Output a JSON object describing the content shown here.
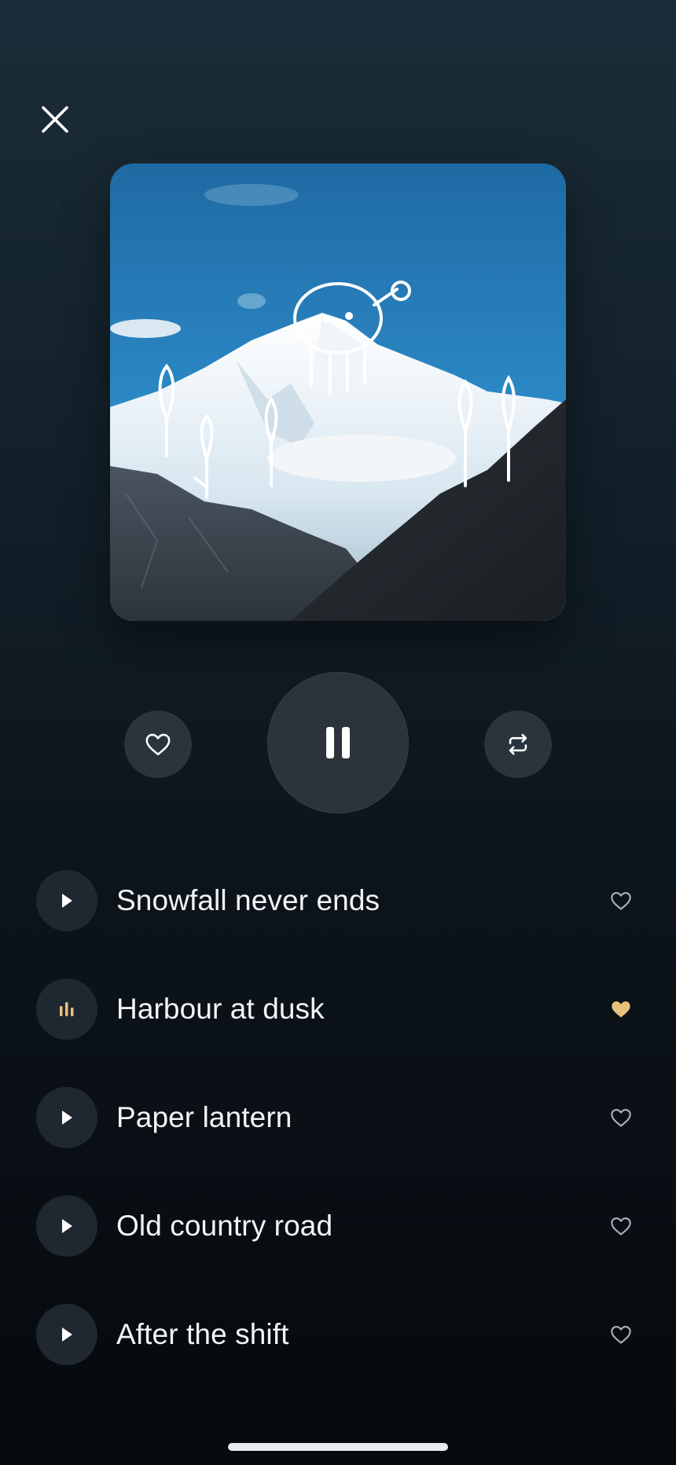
{
  "colors": {
    "accent": "#e8c27a",
    "icon": "#ffffff",
    "muted_icon": "#aab2b9"
  },
  "header": {
    "close_icon": "close-icon"
  },
  "artwork": {
    "subject": "snowy-mountain-with-doodle-illustration"
  },
  "controls": {
    "like_icon": "heart-outline-icon",
    "play_state_icon": "pause-icon",
    "repeat_icon": "repeat-icon"
  },
  "tracks": [
    {
      "title": "Snowfall never ends",
      "state": "paused",
      "liked": false
    },
    {
      "title": "Harbour at dusk",
      "state": "playing",
      "liked": true
    },
    {
      "title": "Paper lantern",
      "state": "paused",
      "liked": false
    },
    {
      "title": "Old country road",
      "state": "paused",
      "liked": false
    },
    {
      "title": "After the shift",
      "state": "paused",
      "liked": false
    }
  ]
}
